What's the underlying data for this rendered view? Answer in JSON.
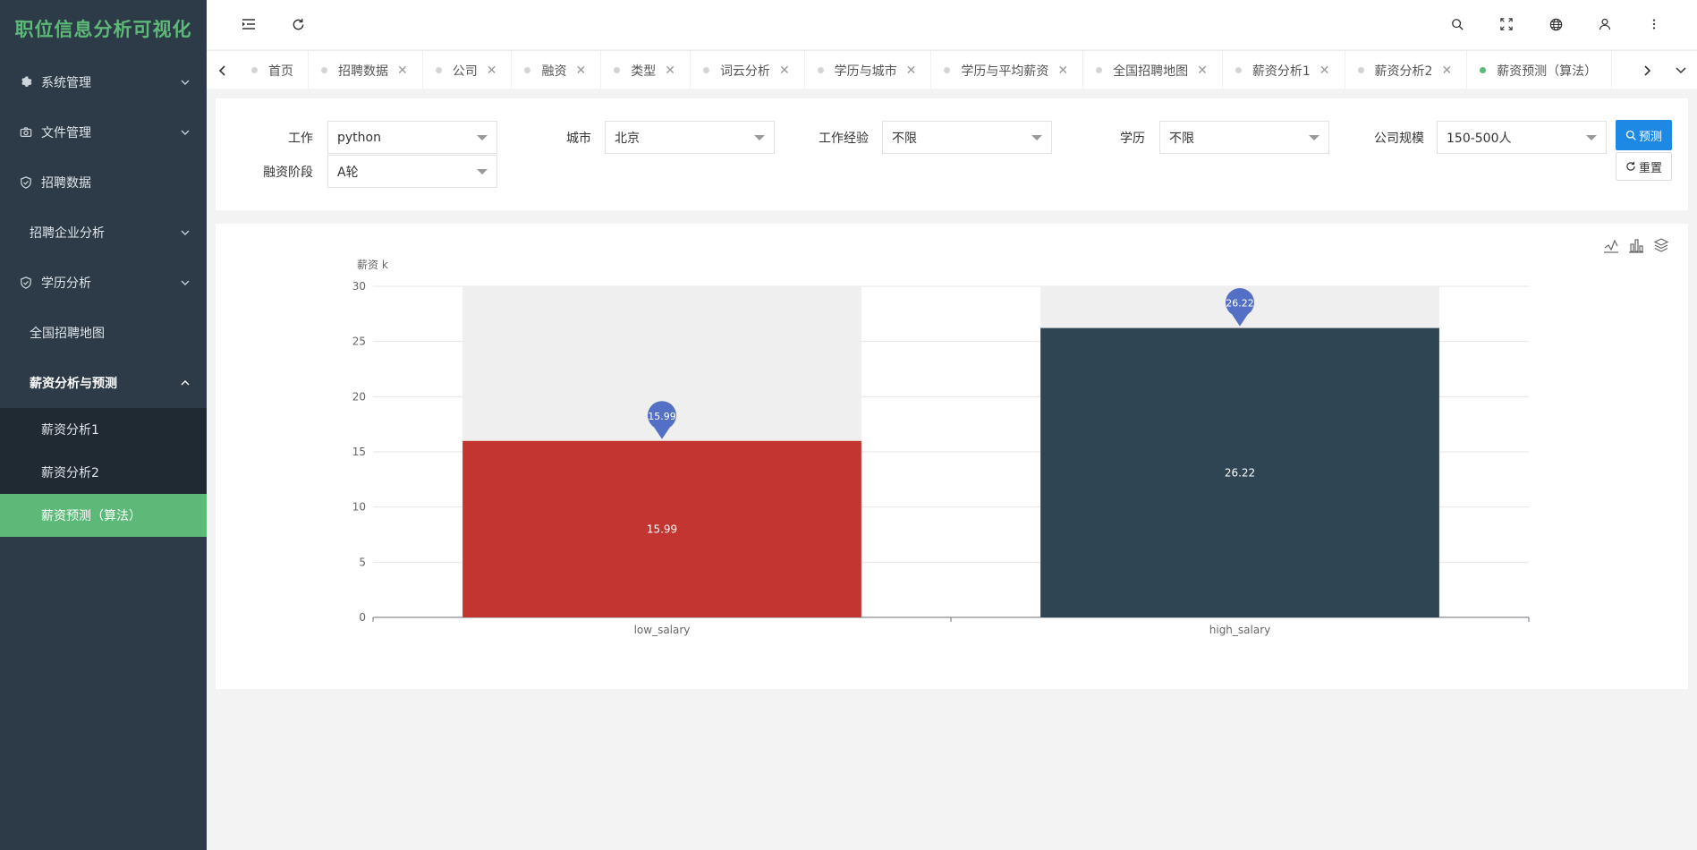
{
  "app": {
    "title": "职位信息分析可视化"
  },
  "sidebar": {
    "items": [
      {
        "label": "系统管理",
        "icon": "gear-icon",
        "has_children": true
      },
      {
        "label": "文件管理",
        "icon": "camera-icon",
        "has_children": true
      },
      {
        "label": "招聘数据",
        "icon": "shield-check-icon",
        "has_children": false
      },
      {
        "label": "招聘企业分析",
        "icon": "",
        "has_children": true
      },
      {
        "label": "学历分析",
        "icon": "shield-check-icon",
        "has_children": true
      },
      {
        "label": "全国招聘地图",
        "icon": "",
        "has_children": false
      },
      {
        "label": "薪资分析与预测",
        "icon": "",
        "has_children": true,
        "expanded": true
      }
    ],
    "subitems": [
      {
        "label": "薪资分析1"
      },
      {
        "label": "薪资分析2"
      },
      {
        "label": "薪资预测（算法）",
        "selected": true
      }
    ]
  },
  "header": {
    "icons": [
      "menu-fold-icon",
      "refresh-icon",
      "search-icon",
      "fullscreen-icon",
      "globe-icon",
      "user-icon",
      "more-vertical-icon"
    ]
  },
  "tabs": [
    {
      "label": "首页",
      "closable": false
    },
    {
      "label": "招聘数据",
      "closable": true
    },
    {
      "label": "公司",
      "closable": true
    },
    {
      "label": "融资",
      "closable": true
    },
    {
      "label": "类型",
      "closable": true
    },
    {
      "label": "词云分析",
      "closable": true
    },
    {
      "label": "学历与城市",
      "closable": true
    },
    {
      "label": "学历与平均薪资",
      "closable": true
    },
    {
      "label": "全国招聘地图",
      "closable": true
    },
    {
      "label": "薪资分析1",
      "closable": true
    },
    {
      "label": "薪资分析2",
      "closable": true
    },
    {
      "label": "薪资预测（算法）",
      "closable": true,
      "active": true
    }
  ],
  "filters": {
    "job": {
      "label": "工作",
      "value": "python"
    },
    "city": {
      "label": "城市",
      "value": "北京"
    },
    "experience": {
      "label": "工作经验",
      "value": "不限"
    },
    "education": {
      "label": "学历",
      "value": "不限"
    },
    "company_size": {
      "label": "公司规模",
      "value": "150-500人"
    },
    "funding": {
      "label": "融资阶段",
      "value": "A轮"
    },
    "predict_label": "预测",
    "reset_label": "重置"
  },
  "chart_data": {
    "type": "bar",
    "ylabel": "薪资 k",
    "ylim": [
      0,
      30
    ],
    "yticks": [
      "0",
      "5",
      "10",
      "15",
      "20",
      "25",
      "30"
    ],
    "categories": [
      "low_salary",
      "high_salary"
    ],
    "values": [
      15.99,
      26.22
    ],
    "value_labels": [
      "15.99",
      "26.22"
    ],
    "colors": [
      "#c23531",
      "#2f4554"
    ],
    "background_bar": true,
    "markpoint": "max",
    "markpoint_color": "#5470c6",
    "toolbox": [
      "line-chart-icon",
      "bar-chart-icon",
      "stack-icon"
    ]
  }
}
